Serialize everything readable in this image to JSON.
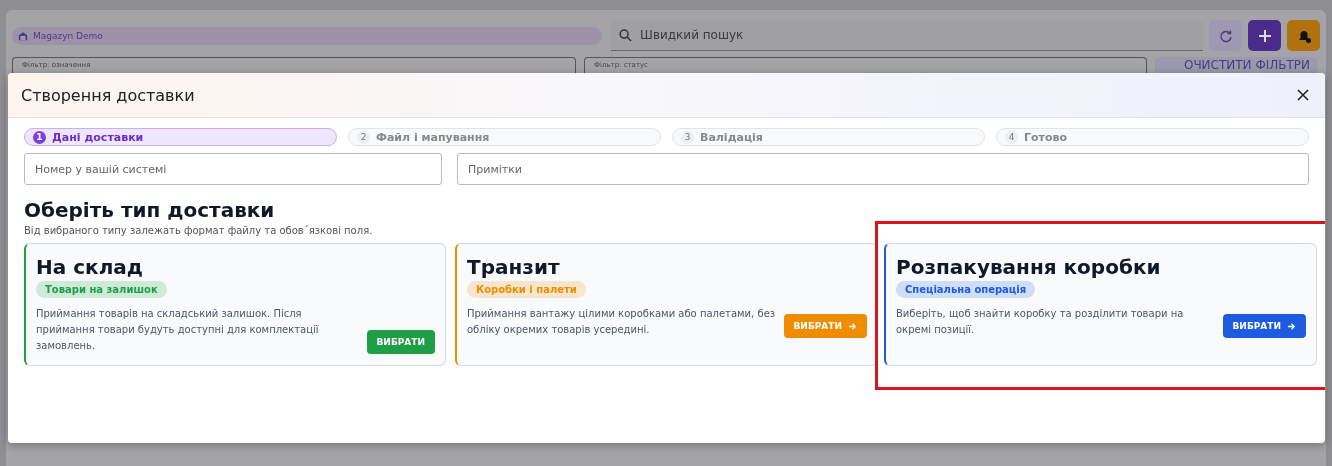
{
  "app": {
    "brand": "Magazyn Demo",
    "search": {
      "placeholder": "Швидкий пошук"
    },
    "filters": [
      {
        "label": "Фільтр: означення"
      },
      {
        "label": "Фільтр: статус"
      }
    ],
    "clear_button": "ОЧИСТИТИ ФІЛЬТРИ"
  },
  "dialog": {
    "title": "Створення доставки",
    "steps": [
      {
        "number": "1",
        "label": "Дані доставки",
        "selected": true
      },
      {
        "number": "2",
        "label": "Файл і мапування",
        "selected": false
      },
      {
        "number": "3",
        "label": "Валідація",
        "selected": false
      },
      {
        "number": "4",
        "label": "Готово",
        "selected": false
      }
    ],
    "fields": [
      {
        "placeholder": "Номер у вашій системі"
      },
      {
        "placeholder": "Примітки"
      }
    ],
    "heading": "Оберіть тип доставки",
    "subheading": "Від вибраного типу залежать формат файлу та обов΄язкові поля.",
    "cards": [
      {
        "title": "На склад",
        "tag": "Товари на залишок",
        "color": "#1e9e45",
        "description": "Приймання товарів на складський залишок. Після приймання товари будуть доступні для комплектації замовлень.",
        "button": "ВИБРАТИ",
        "arrow": false,
        "highlighted": false
      },
      {
        "title": "Транзит",
        "tag": "Коробки і палети",
        "color": "#f08c00",
        "description": "Приймання вантажу цілими коробками або палетами, без обліку окремих товарів усередині.",
        "button": "ВИБРАТИ",
        "arrow": true,
        "highlighted": false
      },
      {
        "title": "Розпакування коробки",
        "tag": "Спеціальна операція",
        "color": "#1e5be0",
        "description": "Виберіть, щоб знайти коробку та розділити товари на окремі позиції.",
        "button": "ВИБРАТИ",
        "arrow": true,
        "highlighted": true
      }
    ]
  }
}
